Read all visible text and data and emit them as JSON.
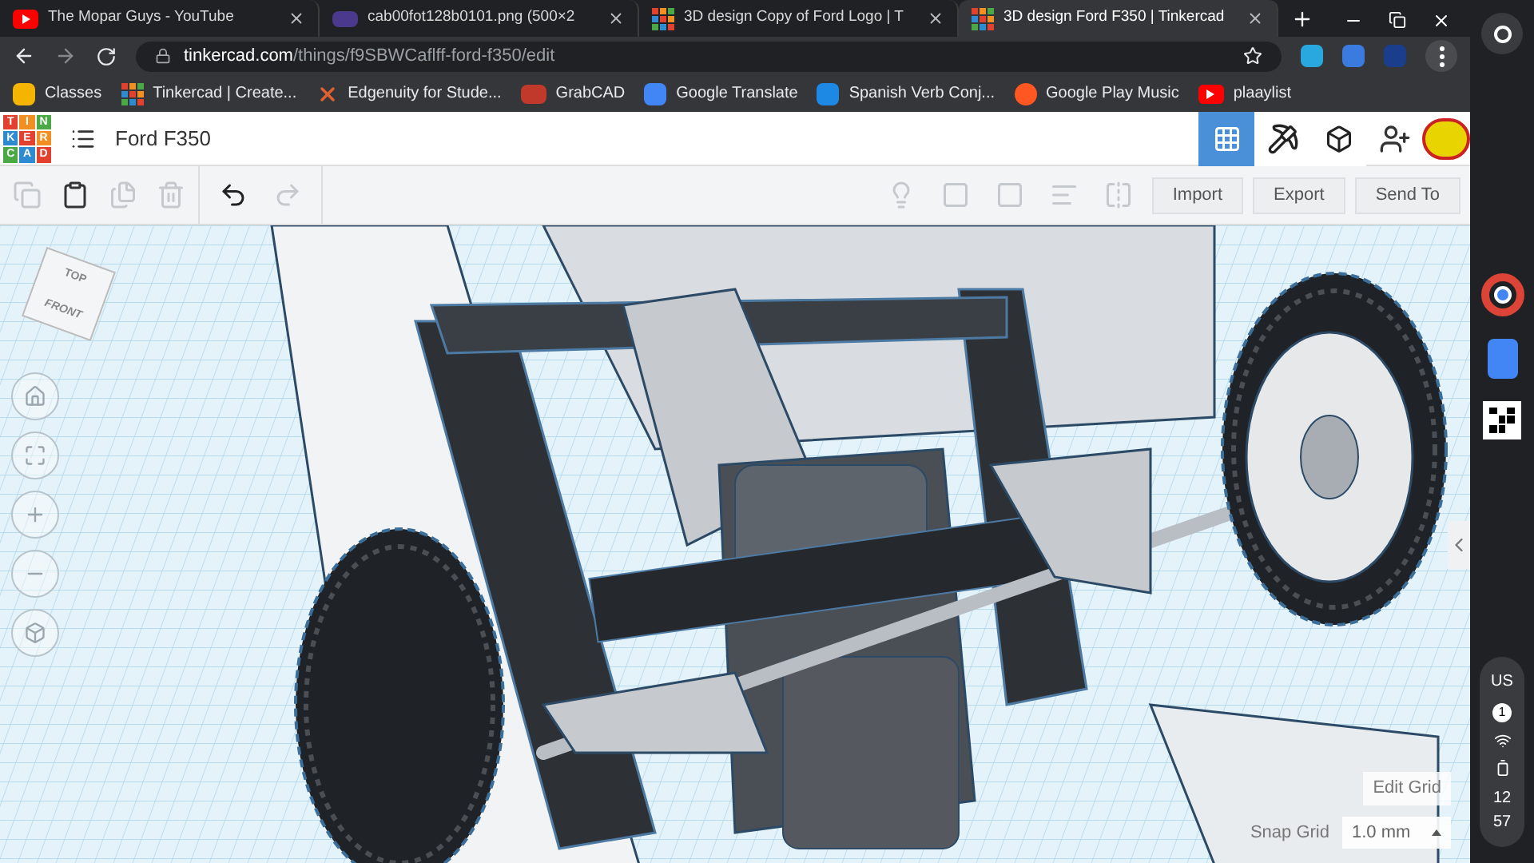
{
  "browser": {
    "tabs": [
      {
        "title": "The Mopar Guys - YouTube",
        "selected": false
      },
      {
        "title": "cab00fot128b0101.png (500×2",
        "selected": false
      },
      {
        "title": "3D design Copy of Ford Logo | T",
        "selected": false
      },
      {
        "title": "3D design Ford F350 | Tinkercad",
        "selected": true
      }
    ],
    "address": {
      "host": "tinkercad.com",
      "path": "/things/f9SBWCaflff-ford-f350/edit"
    },
    "bookmarks": [
      {
        "label": "Classes"
      },
      {
        "label": "Tinkercad | Create..."
      },
      {
        "label": "Edgenuity for Stude..."
      },
      {
        "label": "GrabCAD"
      },
      {
        "label": "Google Translate"
      },
      {
        "label": "Spanish Verb Conj..."
      },
      {
        "label": "Google Play Music"
      },
      {
        "label": "plaaylist"
      }
    ]
  },
  "app": {
    "logo_letters": [
      "T",
      "I",
      "N",
      "K",
      "E",
      "R",
      "C",
      "A",
      "D"
    ],
    "design_title": "Ford F350",
    "views": [
      {
        "kind": "grid",
        "selected": true
      },
      {
        "kind": "pickaxe",
        "selected": false
      },
      {
        "kind": "bricks",
        "selected": false
      }
    ],
    "toolbar_buttons": [
      "Import",
      "Export",
      "Send To"
    ],
    "view_cube": {
      "top": "TOP",
      "front": "FRONT"
    },
    "edit_grid": "Edit Grid",
    "snap_label": "Snap Grid",
    "snap_value": "1.0 mm"
  },
  "shelf": {
    "keyboard": "US",
    "notifications": "1",
    "time_hour": "12",
    "time_minute": "57"
  }
}
